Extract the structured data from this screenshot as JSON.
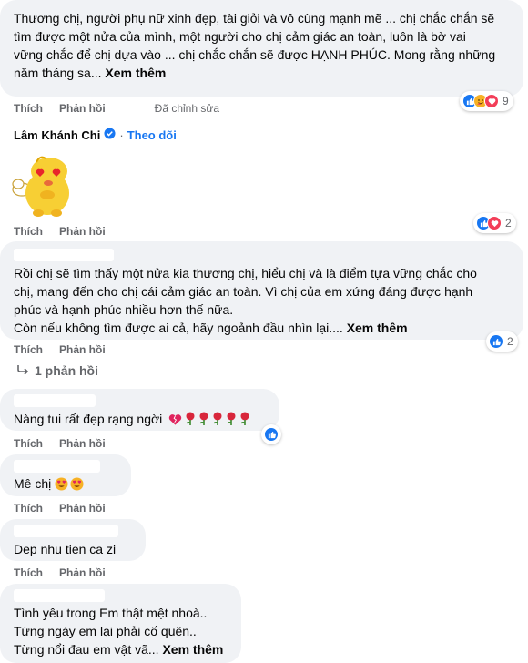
{
  "comments": [
    {
      "lines": [
        "Thương chị, người phụ nữ xinh đẹp, tài giỏi và vô cùng mạnh mẽ ... chị chắc chắn sẽ",
        "tìm được một nửa của mình, một người cho chị cảm giác an toàn, luôn là bờ vai",
        "vững chắc để chị dựa vào ... chị chắc chắn sẽ được HẠNH PHÚC. Mong rằng những",
        "năm tháng sa..."
      ],
      "see_more": "Xem thêm",
      "like": "Thích",
      "reply": "Phản hồi",
      "edited": "Đã chỉnh sửa",
      "reaction_count": "9"
    },
    {
      "author": "Lâm Khánh Chi",
      "follow": "Theo dõi",
      "like": "Thích",
      "reply": "Phản hồi",
      "reaction_count": "2"
    },
    {
      "lines": [
        "Rồi chị sẽ tìm thấy một nửa kia thương chị, hiểu chị và là điểm tựa vững chắc cho",
        "chị, mang đến cho chị cái cảm giác an toàn. Vì chị của em xứng đáng được hạnh",
        "phúc và hạnh phúc nhiều hơn thế nữa.",
        "Còn nếu không tìm được ai cả, hãy ngoảnh đầu nhìn lại...."
      ],
      "see_more": "Xem thêm",
      "like": "Thích",
      "reply": "Phản hồi",
      "reaction_count": "2",
      "replies_label": "1 phản hồi"
    },
    {
      "text": "Nàng tui rất đẹp rạng ngời",
      "like": "Thích",
      "reply": "Phản hồi"
    },
    {
      "text": "Mê chị",
      "like": "Thích",
      "reply": "Phản hồi"
    },
    {
      "text": "Dep nhu tien ca zi",
      "like": "Thích",
      "reply": "Phản hồi"
    },
    {
      "lines": [
        "Tình yêu trong Em thật mệt nhoà..",
        "Từng ngày em lại phải cố quên..",
        "Từng nổi đau em vật vã..."
      ],
      "see_more": "Xem thêm"
    }
  ],
  "colors": {
    "bubble": "#f0f2f5",
    "action_text": "#65676b",
    "link_blue": "#1877f2",
    "like_blue": "#1877f2",
    "love_red": "#f33e58",
    "haha_yellow": "#f7b125"
  }
}
